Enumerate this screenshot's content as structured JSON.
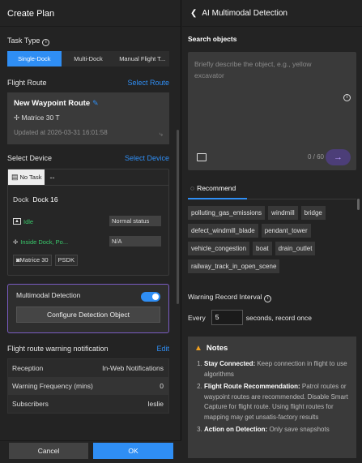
{
  "left": {
    "title": "Create Plan",
    "task_type": {
      "label": "Task Type",
      "options": [
        "Single-Dock",
        "Multi-Dock",
        "Manual Flight T..."
      ],
      "selected": "Single-Dock"
    },
    "flight_route": {
      "label": "Flight Route",
      "action": "Select Route",
      "name": "New Waypoint Route",
      "model": "Matrice 30 T",
      "updated": "Updated at 2026-03-31 16:01:58"
    },
    "device": {
      "label": "Select Device",
      "action": "Select Device",
      "task_badge": "No Task",
      "task_value": "--",
      "dock_label": "Dock",
      "dock_name": "Dock 16",
      "dock_state": "Idle",
      "dock_status": "Normal status",
      "drone_state": "Inside Dock, Po...",
      "drone_value": "N/A",
      "drone_model": "Matrice 30",
      "drone_sdk": "PSDK"
    },
    "multimodal": {
      "label": "Multimodal Detection",
      "enabled": true,
      "configure": "Configure Detection Object"
    },
    "warning": {
      "label": "Flight route warning notification",
      "action": "Edit",
      "rows": [
        {
          "key": "Reception",
          "value": "In-Web Notifications"
        },
        {
          "key": "Warning Frequency (mins)",
          "value": "0"
        },
        {
          "key": "Subscribers",
          "value": "leslie"
        }
      ]
    },
    "footer": {
      "cancel": "Cancel",
      "ok": "OK"
    }
  },
  "right": {
    "title": "AI Multimodal Detection",
    "search": {
      "label": "Search objects",
      "placeholder": "Briefly describe the object, e.g., yellow excavator",
      "count": "0 / 60"
    },
    "recommend_tab": "Recommend",
    "chips": [
      "polluting_gas_emissions",
      "windmill",
      "bridge",
      "defect_windmill_blade",
      "pendant_tower",
      "vehicle_congestion",
      "boat",
      "drain_outlet",
      "railway_track_in_open_scene"
    ],
    "interval": {
      "label": "Warning Record Interval",
      "prefix": "Every",
      "value": "5",
      "suffix": "seconds, record once"
    },
    "notes": {
      "title": "Notes",
      "items": [
        {
          "head": "Stay Connected:",
          "text": " Keep connection in flight to use algorithms"
        },
        {
          "head": "Flight Route Recommendation:",
          "text": " Patrol routes or waypoint routes are recommended. Disable Smart Capture for flight route. Using flight routes for mapping may get unsatis-factory results"
        },
        {
          "head": "Action on Detection:",
          "text": " Only save snapshots"
        }
      ]
    }
  },
  "colors": {
    "accent": "#2f8ef4",
    "purple": "#7a5cc2",
    "green": "#39c96b",
    "warn": "#f0a020"
  }
}
